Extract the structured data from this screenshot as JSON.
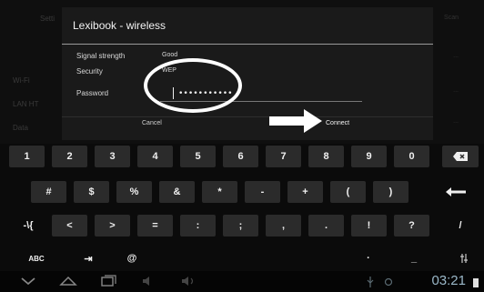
{
  "background": {
    "left_items": [
      "Setti",
      "Wi-Fi",
      "LAN HT",
      "Data"
    ],
    "right_items": [
      "Scan",
      "...",
      "...",
      "..."
    ]
  },
  "dialog": {
    "title": "Lexibook - wireless",
    "rows": [
      {
        "label": "Signal strength",
        "value": "Good"
      },
      {
        "label": "Security",
        "value": "WEP"
      },
      {
        "label": "Password",
        "value": "•••••••••••"
      }
    ],
    "cancel_label": "Cancel",
    "connect_label": "Connect"
  },
  "keyboard": {
    "row1": [
      "1",
      "2",
      "3",
      "4",
      "5",
      "6",
      "7",
      "8",
      "9",
      "0"
    ],
    "row2": [
      "#",
      "$",
      "%",
      "&",
      "*",
      "-",
      "+",
      "(",
      ")"
    ],
    "row3": [
      "-\\{",
      "<",
      ">",
      "=",
      ":",
      ";",
      ",",
      ".",
      "!",
      "?",
      "/"
    ],
    "abc_label": "ABC",
    "tab_label": "⇥",
    "at_label": "@",
    "backspace_icon": "backspace-icon",
    "enter_icon": "enter-icon"
  },
  "status_bar": {
    "time": "03:21"
  },
  "colors": {
    "annotation": "#ffffff",
    "clock": "#9ab7c8"
  }
}
